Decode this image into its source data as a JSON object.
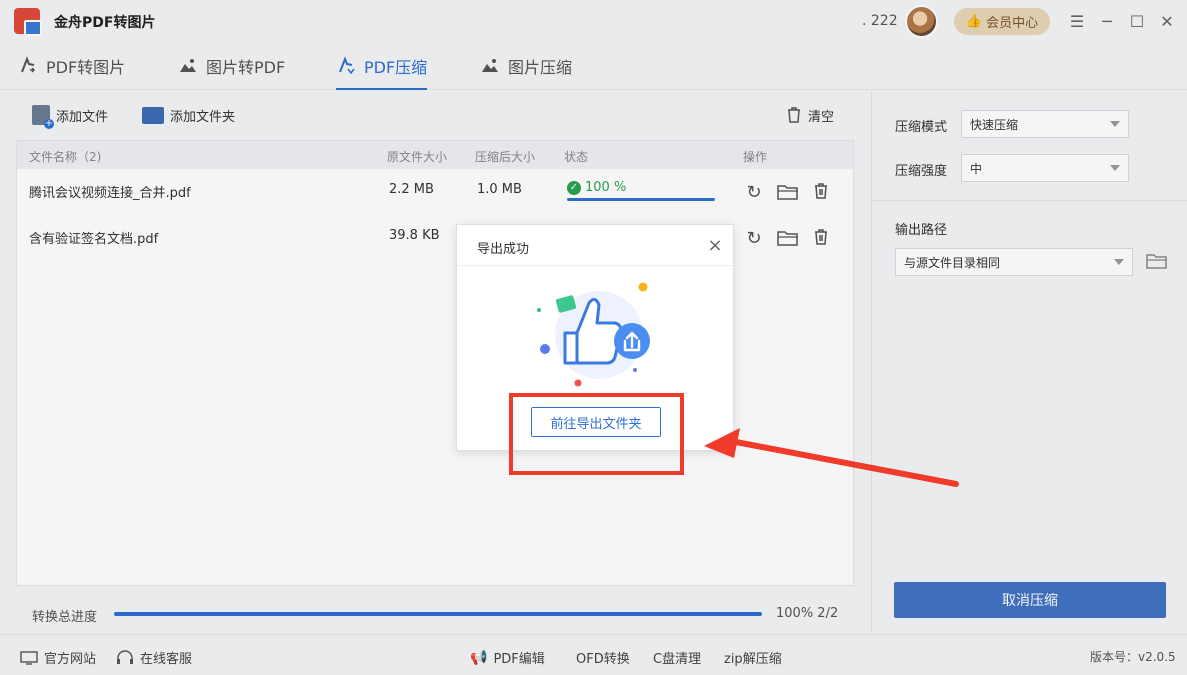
{
  "app": {
    "title": "金舟PDF转图片",
    "user_count": ". 222",
    "vip_label": "会员中心"
  },
  "tabs": [
    {
      "label": "PDF转图片"
    },
    {
      "label": "图片转PDF"
    },
    {
      "label": "PDF压缩",
      "active": true
    },
    {
      "label": "图片压缩"
    }
  ],
  "toolbar": {
    "add_file": "添加文件",
    "add_folder": "添加文件夹",
    "clear": "清空"
  },
  "table": {
    "headers": [
      "文件名称（2)",
      "原文件大小",
      "压缩后大小",
      "状态",
      "操作"
    ],
    "rows": [
      {
        "name": "腾讯会议视频连接_合并.pdf",
        "orig_size": "2.2 MB",
        "new_size": "1.0 MB",
        "status": "100 %",
        "progress": 1.0
      },
      {
        "name": "含有验证签名文档.pdf",
        "orig_size": "39.8 KB",
        "new_size": "",
        "status": "",
        "progress": 1.0
      }
    ]
  },
  "total": {
    "label": "转换总进度",
    "value": "100% 2/2",
    "progress": 1.0
  },
  "settings": {
    "mode_label": "压缩模式",
    "mode_value": "快速压缩",
    "strength_label": "压缩强度",
    "strength_value": "中",
    "output_label": "输出路径",
    "output_value": "与源文件目录相同",
    "cancel_label": "取消压缩"
  },
  "footer": {
    "website": "官方网站",
    "support": "在线客服",
    "links": [
      "PDF编辑",
      "OFD转换",
      "C盘清理",
      "zip解压缩"
    ],
    "version": "版本号：v2.0.5"
  },
  "dialog": {
    "title": "导出成功",
    "button": "前往导出文件夹"
  },
  "colors": {
    "accent": "#2f6fd6",
    "success": "#2aa34f",
    "highlight": "#f03b2b"
  }
}
